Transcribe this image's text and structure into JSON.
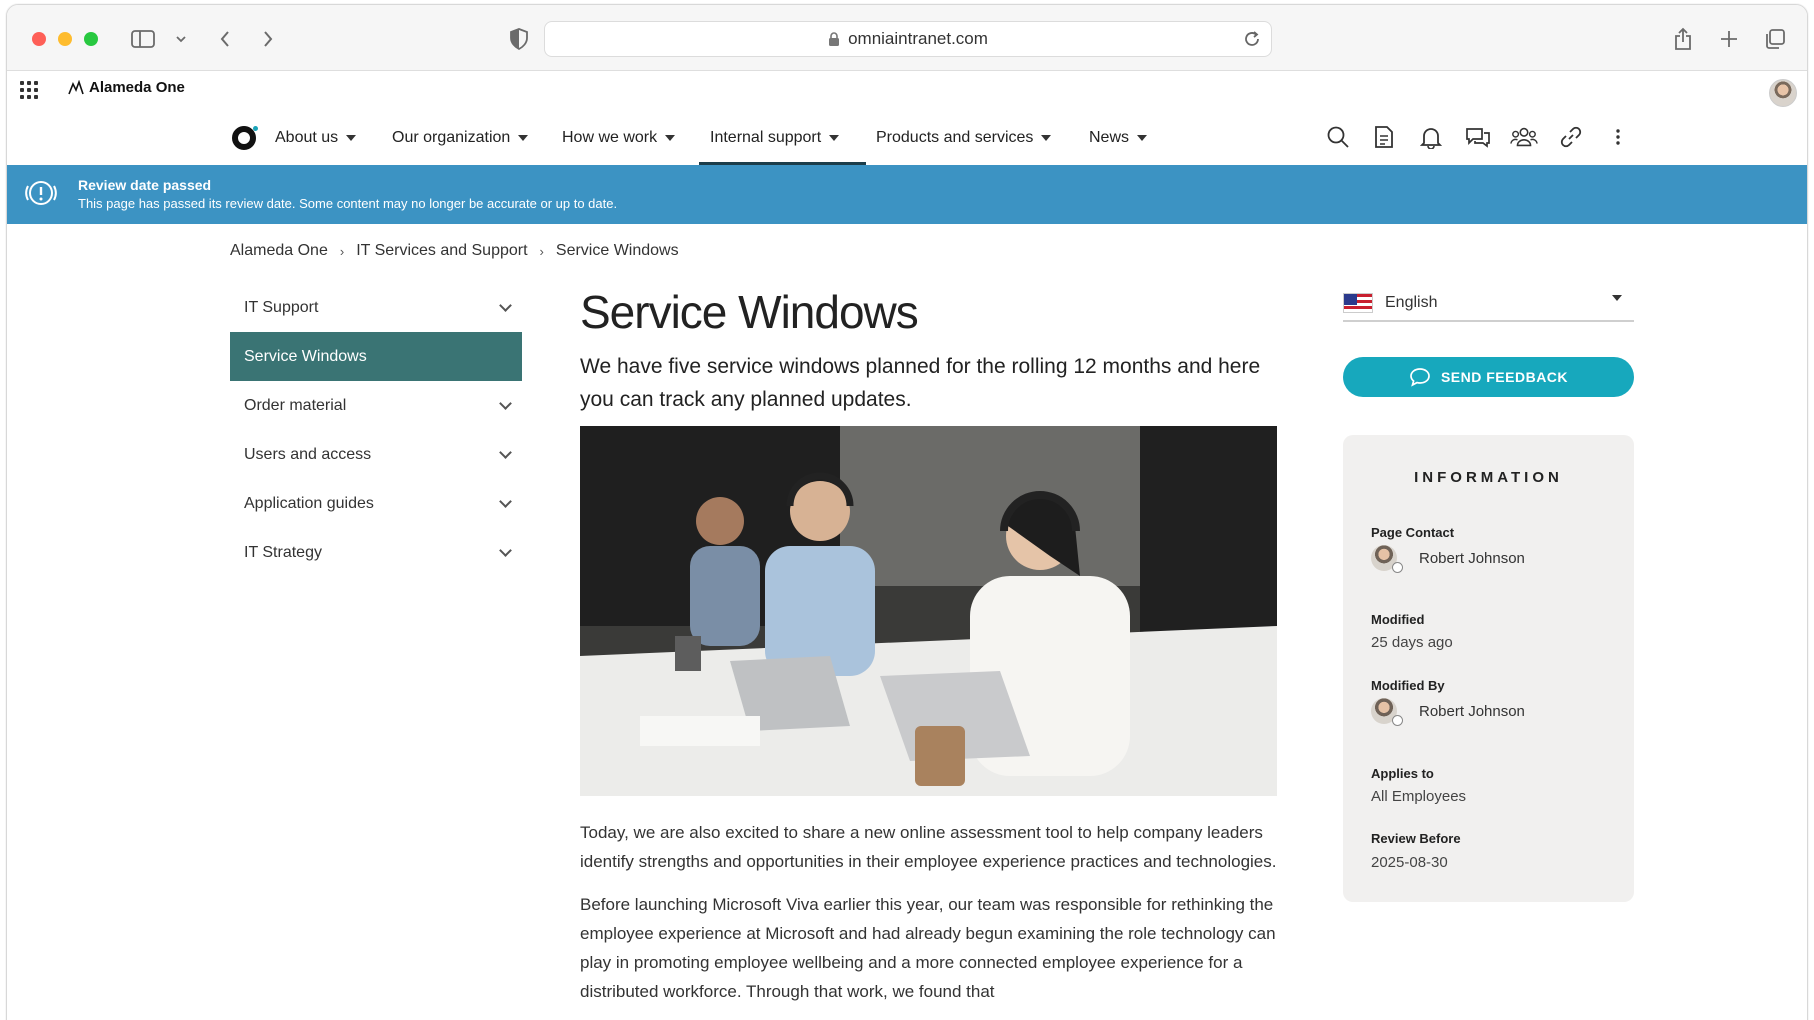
{
  "browser": {
    "url": "omniaintranet.com"
  },
  "app": {
    "brand": "Alameda One"
  },
  "nav": {
    "items": [
      {
        "label": "About us"
      },
      {
        "label": "Our organization"
      },
      {
        "label": "How we work"
      },
      {
        "label": "Internal support"
      },
      {
        "label": "Products and services"
      },
      {
        "label": "News"
      }
    ],
    "active_index": 3
  },
  "banner": {
    "title": "Review date passed",
    "text": "This page has passed its review date. Some content may no longer be accurate or up to date."
  },
  "breadcrumb": [
    "Alameda One",
    "IT Services and Support",
    "Service Windows"
  ],
  "leftnav": {
    "items": [
      {
        "label": "IT Support"
      },
      {
        "label": "Service Windows"
      },
      {
        "label": "Order material"
      },
      {
        "label": "Users and access"
      },
      {
        "label": "Application guides"
      },
      {
        "label": "IT Strategy"
      }
    ],
    "active_index": 1
  },
  "main": {
    "title": "Service Windows",
    "lead": "We have five service windows planned for the rolling 12 months and here you can track any planned updates.",
    "paragraphs": [
      "Today, we are also excited to share a new online assessment tool to help company leaders identify strengths and opportunities in their employee experience practices and technologies.",
      "Before launching Microsoft Viva earlier this year, our team was responsible for rethinking the employee experience at Microsoft and had already begun examining the role technology can play in promoting employee wellbeing and a more connected employee experience for a distributed workforce. Through that work, we found that"
    ]
  },
  "sidebar": {
    "language": "English",
    "feedback_label": "SEND FEEDBACK",
    "info": {
      "title": "INFORMATION",
      "page_contact_label": "Page Contact",
      "page_contact": "Robert Johnson",
      "modified_label": "Modified",
      "modified": "25 days ago",
      "modified_by_label": "Modified By",
      "modified_by": "Robert Johnson",
      "applies_to_label": "Applies to",
      "applies_to": "All Employees",
      "review_before_label": "Review Before",
      "review_before": "2025-08-30"
    }
  },
  "colors": {
    "banner": "#3c93c3",
    "active_nav": "#3a7474",
    "feedback_button": "#17a8bd"
  }
}
